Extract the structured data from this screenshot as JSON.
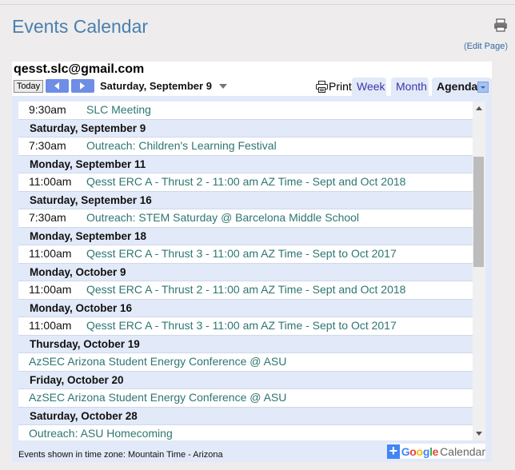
{
  "page": {
    "title": "Events Calendar",
    "edit_prefix": "(",
    "edit_link": "Edit Page",
    "edit_suffix": ")"
  },
  "calendar": {
    "title": "qesst.slc@gmail.com",
    "today_label": "Today",
    "current_date": "Saturday, September 9",
    "print_label": "Print",
    "tabs": [
      {
        "label": "Week",
        "active": false
      },
      {
        "label": "Month",
        "active": false
      },
      {
        "label": "Agenda",
        "active": true
      }
    ],
    "rows": [
      {
        "type": "event",
        "time": "9:30am",
        "title": "SLC Meeting"
      },
      {
        "type": "day",
        "label": "Saturday, September 9"
      },
      {
        "type": "event",
        "time": "7:30am",
        "title": "Outreach: Children's Learning Festival"
      },
      {
        "type": "day",
        "label": "Monday, September 11"
      },
      {
        "type": "event",
        "time": "11:00am",
        "title": "Qesst ERC A - Thrust 2 - 11:00 am AZ Time - Sept and Oct 2018"
      },
      {
        "type": "day",
        "label": "Saturday, September 16"
      },
      {
        "type": "event",
        "time": "7:30am",
        "title": "Outreach: STEM Saturday @ Barcelona Middle School"
      },
      {
        "type": "day",
        "label": "Monday, September 18"
      },
      {
        "type": "event",
        "time": "11:00am",
        "title": "Qesst ERC A - Thrust 3 - 11:00 am AZ Time - Sept to Oct 2017"
      },
      {
        "type": "day",
        "label": "Monday, October 9"
      },
      {
        "type": "event",
        "time": "11:00am",
        "title": "Qesst ERC A - Thrust 2 - 11:00 am AZ Time - Sept and Oct 2018"
      },
      {
        "type": "day",
        "label": "Monday, October 16"
      },
      {
        "type": "event",
        "time": "11:00am",
        "title": "Qesst ERC A - Thrust 3 - 11:00 am AZ Time - Sept to Oct 2017"
      },
      {
        "type": "day",
        "label": "Thursday, October 19"
      },
      {
        "type": "event",
        "time": "",
        "title": "AzSEC Arizona Student Energy Conference @ ASU"
      },
      {
        "type": "day",
        "label": "Friday, October 20"
      },
      {
        "type": "event",
        "time": "",
        "title": "AzSEC Arizona Student Energy Conference @ ASU"
      },
      {
        "type": "day",
        "label": "Saturday, October 28"
      },
      {
        "type": "event",
        "time": "",
        "title": "Outreach: ASU Homecoming"
      }
    ],
    "timezone_note": "Events shown in time zone: Mountain Time - Arizona",
    "badge": {
      "plus": "+",
      "google_letters": [
        {
          "ch": "G",
          "color": "#4285f4"
        },
        {
          "ch": "o",
          "color": "#ea4335"
        },
        {
          "ch": "o",
          "color": "#fbbc05"
        },
        {
          "ch": "g",
          "color": "#4285f4"
        },
        {
          "ch": "l",
          "color": "#34a853"
        },
        {
          "ch": "e",
          "color": "#ea4335"
        }
      ],
      "calendar_word": "Calendar"
    }
  },
  "colors": {
    "title_blue": "#4a7fae",
    "event_green": "#2d7672",
    "tab_bg": "#e2e9f8",
    "nav_button": "#6d8de6"
  }
}
